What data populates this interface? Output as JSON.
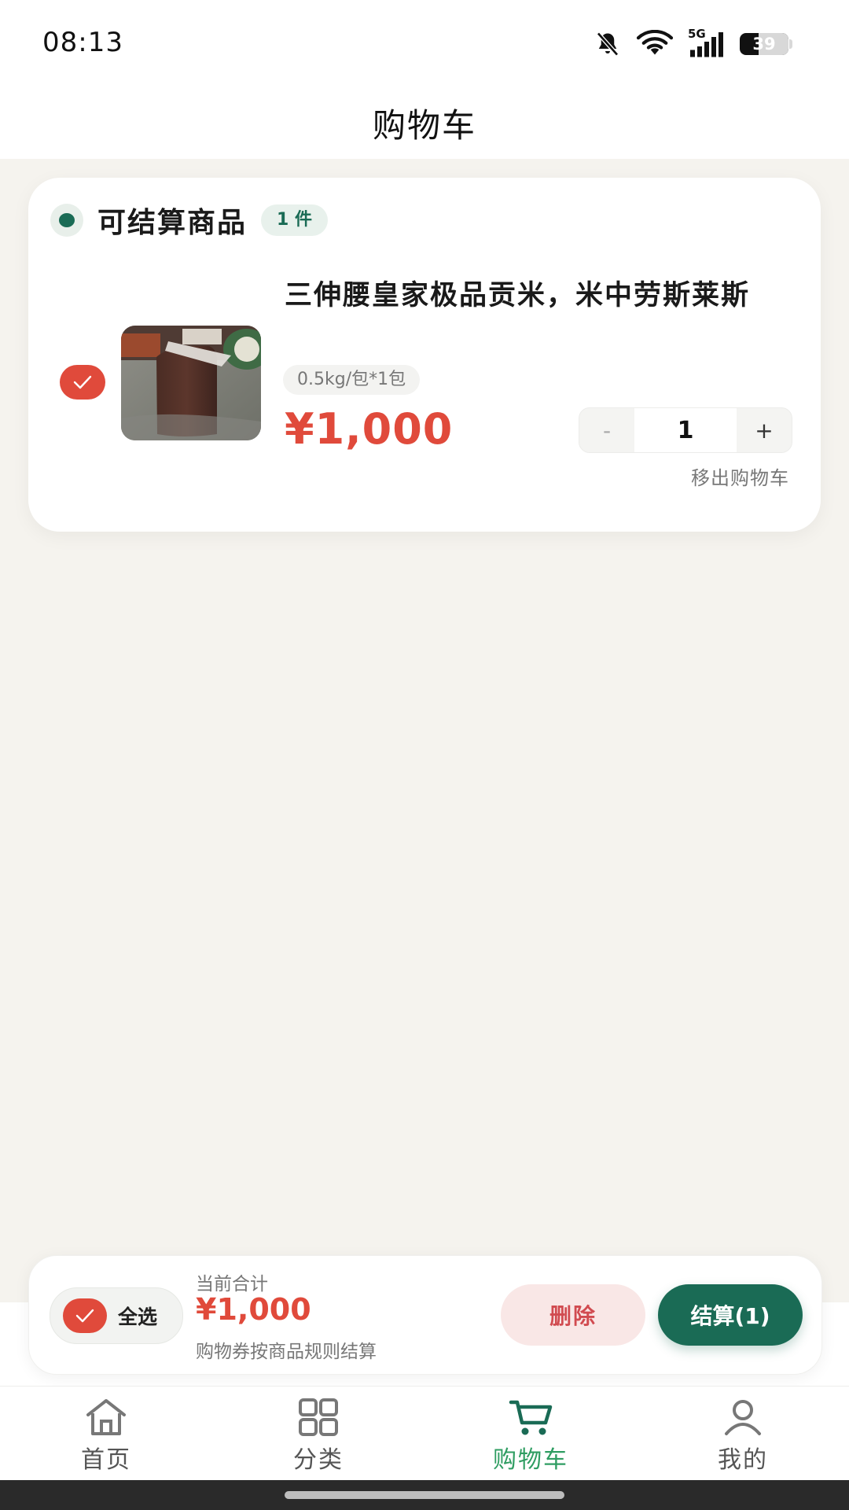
{
  "status_bar": {
    "time": "08:13",
    "battery": "39",
    "battery_level": 0.39,
    "network_label": "5G",
    "icons": [
      "bell-off-icon",
      "wifi-icon",
      "5g-signal-icon",
      "battery-icon"
    ]
  },
  "header": {
    "title": "购物车"
  },
  "cart": {
    "group_title": "可结算商品",
    "group_count": "1 件",
    "item": {
      "name": "三伸腰皇家极品贡米，米中劳斯莱斯",
      "spec": "0.5kg/包*1包",
      "price": "¥1,000",
      "quantity": "1",
      "minus_label": "-",
      "plus_label": "+",
      "remove_label": "移出购物车",
      "selected": true
    }
  },
  "action_bar": {
    "select_all_label": "全选",
    "total_label": "当前合计",
    "total_value": "¥1,000",
    "total_note": "购物券按商品规则结算",
    "delete_label": "删除",
    "checkout_label": "结算(1)"
  },
  "tabs": [
    {
      "label": "首页",
      "icon": "home-icon",
      "active": false
    },
    {
      "label": "分类",
      "icon": "grid-icon",
      "active": false
    },
    {
      "label": "购物车",
      "icon": "cart-icon",
      "active": true
    },
    {
      "label": "我的",
      "icon": "user-icon",
      "active": false
    }
  ],
  "colors": {
    "accent_green": "#1A6B55",
    "price_red": "#E04A3B",
    "tab_active": "#2F9D62",
    "page_bg": "#F5F3EE"
  }
}
